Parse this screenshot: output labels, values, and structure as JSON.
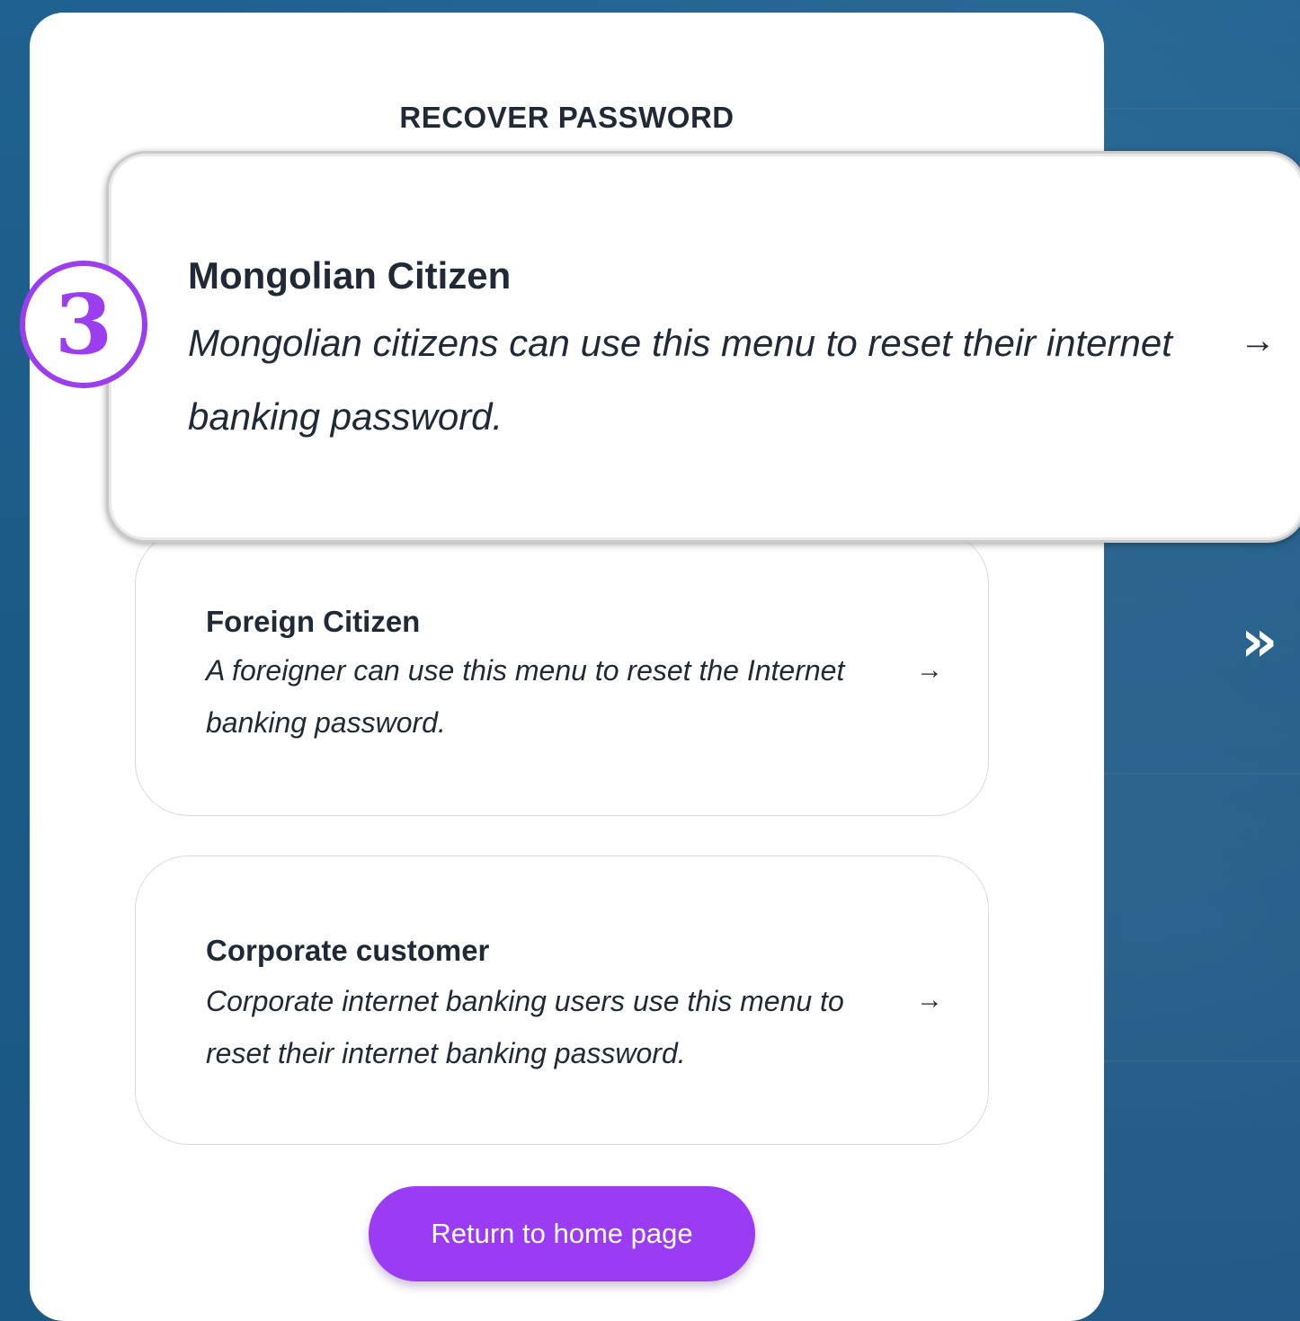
{
  "page": {
    "title": "RECOVER PASSWORD"
  },
  "options": [
    {
      "title": "Mongolian Citizen",
      "description": "Mongolian citizens can use this menu to reset their internet banking password.",
      "arrow": "→"
    },
    {
      "title": "Foreign Citizen",
      "description": "A foreigner can use this menu to reset the Internet banking password.",
      "arrow": "→"
    },
    {
      "title": "Corporate customer",
      "description": "Corporate internet banking users use this menu to reset their internet banking password.",
      "arrow": "→"
    }
  ],
  "return_button": {
    "label": "Return to home page"
  },
  "step_badge": {
    "number": "3"
  },
  "next_indicator": {
    "glyph": "»"
  },
  "colors": {
    "background": "#1d5d8a",
    "accent": "#9b3cf5",
    "text": "#1f2a36",
    "panel": "#ffffff"
  }
}
